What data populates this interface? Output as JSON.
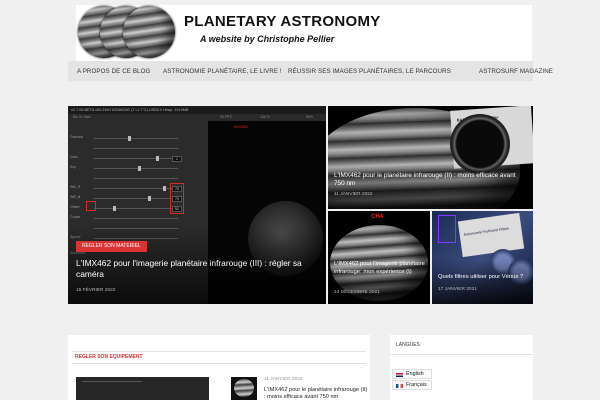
{
  "header": {
    "title": "PLANETARY ASTRONOMY",
    "subtitle": "A website by Christophe Pellier"
  },
  "nav": {
    "items": [
      {
        "label": "A PROPOS DE CE BLOG"
      },
      {
        "label": "ASTRONOMIE PLANÉTAIRE, LE LIVRE !"
      },
      {
        "label": "RÉUSSIR SES IMAGES PLANÉTAIRES, LE PARCOURS"
      },
      {
        "label": "ASTROSURF MAGAZINE"
      }
    ]
  },
  "featured": {
    "main": {
      "category": "REGLER SON MATERIEL",
      "title": "L'IMX462 pour l'imagerie planétaire infrarouge (III) : régler sa caméra",
      "date": "15 FÉVRIER 2022",
      "software": {
        "titlebar": "v2.7.06 BETA x64   ZWO ASI462MC (T=1.7°C) USB3.0   Heap: 1019MB",
        "toolbar": "Bin 2x   Gain",
        "fps": "50 FPS",
        "zoom": "100 %",
        "pct": "50%",
        "labels": [
          "Gamma",
          "",
          "Gain",
          "Exp",
          "",
          "WB_R",
          "WB_B",
          "Offset",
          "Cooler",
          "",
          "",
          "Speed",
          "",
          "AutoGain"
        ],
        "values": [
          "1",
          "79",
          "70",
          "52"
        ],
        "tag": "IMX462"
      }
    },
    "right_top": {
      "title": "L'IMX462 pour le planétaire infrarouge (II) : moins efficace avant 750 nm",
      "date": "11 JANVIER 2022",
      "box_text": "BAADER IR-Pass-Filter"
    },
    "right_mid": {
      "overlay": "CH4",
      "title": "L'IMX462 pour l'imagerie planétaire infrarouge: mon expérience (I)",
      "date": "14 DÉCEMBRE 2021"
    },
    "right_end": {
      "title": "Quels filtres utiliser pour Vénus ?",
      "date": "17 JANVIER 2021",
      "card_text": "Astronomik ProPlanet Filters"
    }
  },
  "content": {
    "section_title": "REGLER SON EQUIPEMENT",
    "list_date": "11 JANVIER 2022",
    "list_title": "L'IMX462 pour le planétaire infrarouge (II) : moins efficace avant 750 nm"
  },
  "sidebar": {
    "title": "LANGUES",
    "languages": [
      {
        "label": "English"
      },
      {
        "label": "Français"
      }
    ]
  },
  "colors": {
    "accent": "#d93333",
    "background": "#f0f0f0",
    "nav_bg": "#e4e4e4"
  }
}
